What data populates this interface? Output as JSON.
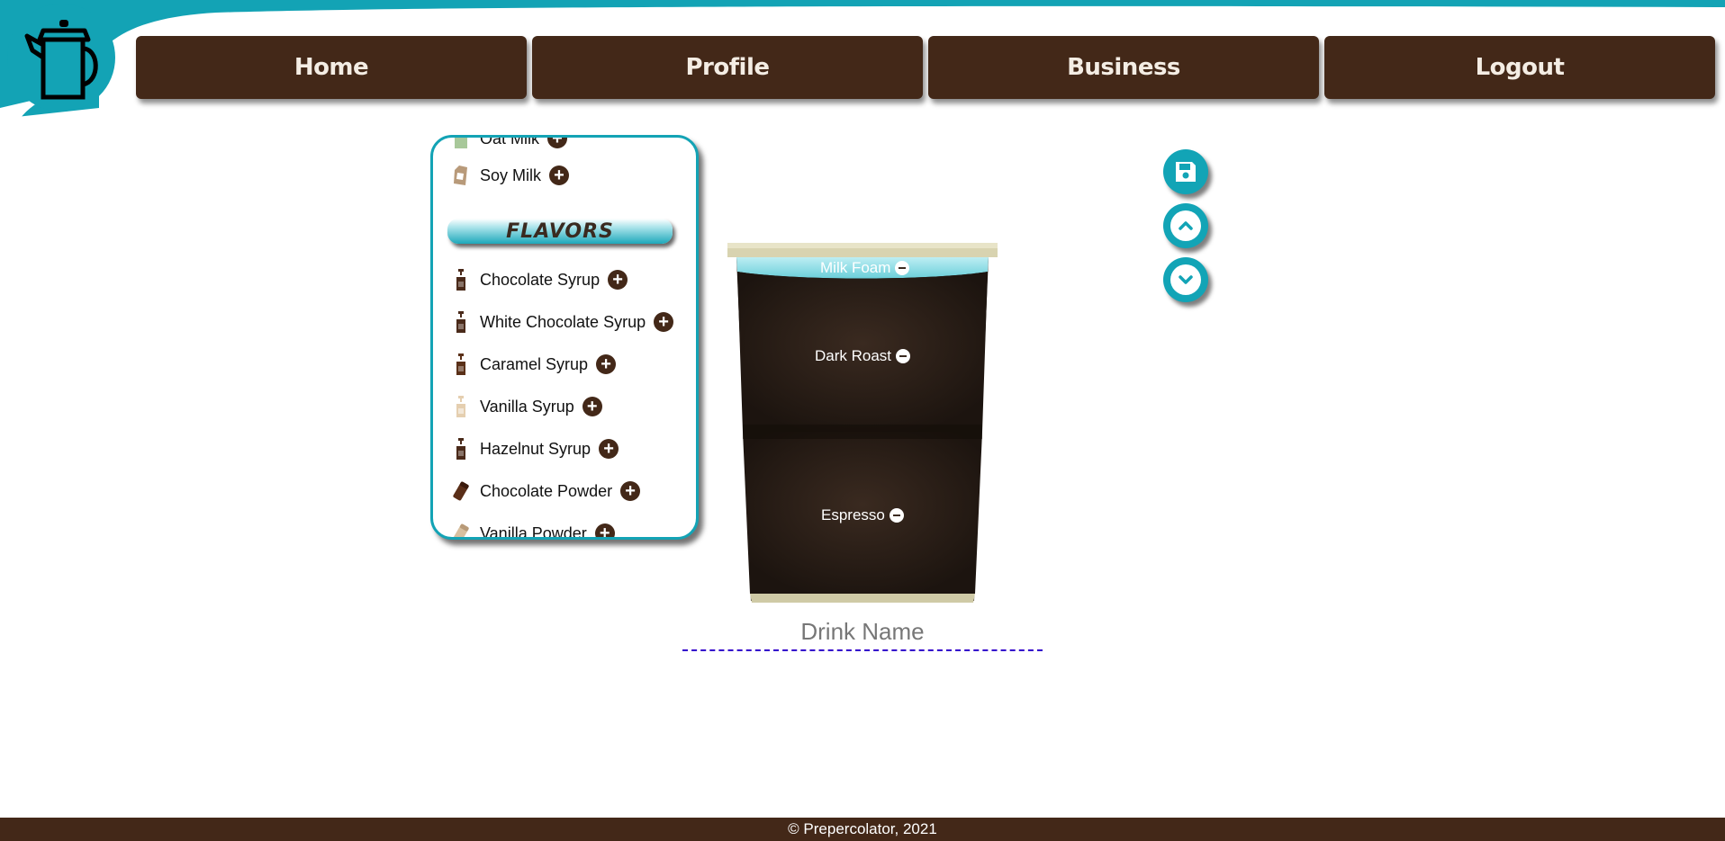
{
  "nav": {
    "items": [
      {
        "label": "Home"
      },
      {
        "label": "Profile"
      },
      {
        "label": "Business"
      },
      {
        "label": "Logout"
      }
    ]
  },
  "ingredients": {
    "partial_top_label": "Oat Milk",
    "soy_milk": "Soy Milk",
    "flavors_heading": "FLAVORS",
    "flavors": [
      {
        "label": "Chocolate Syrup",
        "icon": "syrup-bottle-icon"
      },
      {
        "label": "White Chocolate Syrup",
        "icon": "syrup-bottle-icon"
      },
      {
        "label": "Caramel Syrup",
        "icon": "syrup-bottle-icon"
      },
      {
        "label": "Vanilla Syrup",
        "icon": "syrup-bottle-icon"
      },
      {
        "label": "Hazelnut Syrup",
        "icon": "syrup-bottle-icon"
      },
      {
        "label": "Chocolate Powder",
        "icon": "powder-shaker-icon"
      },
      {
        "label": "Vanilla Powder",
        "icon": "powder-shaker-icon"
      }
    ]
  },
  "cup": {
    "layers": [
      {
        "label": "Milk Foam"
      },
      {
        "label": "Dark Roast"
      },
      {
        "label": "Espresso"
      }
    ]
  },
  "drink_name": {
    "placeholder": "Drink Name",
    "value": ""
  },
  "tools": {
    "save": "save-icon",
    "up": "chevron-up-icon",
    "down": "chevron-down-icon"
  },
  "footer": {
    "text": "© Prepercolator, 2021"
  },
  "colors": {
    "brand_brown": "#432818",
    "accent_teal": "#13a3b5"
  }
}
